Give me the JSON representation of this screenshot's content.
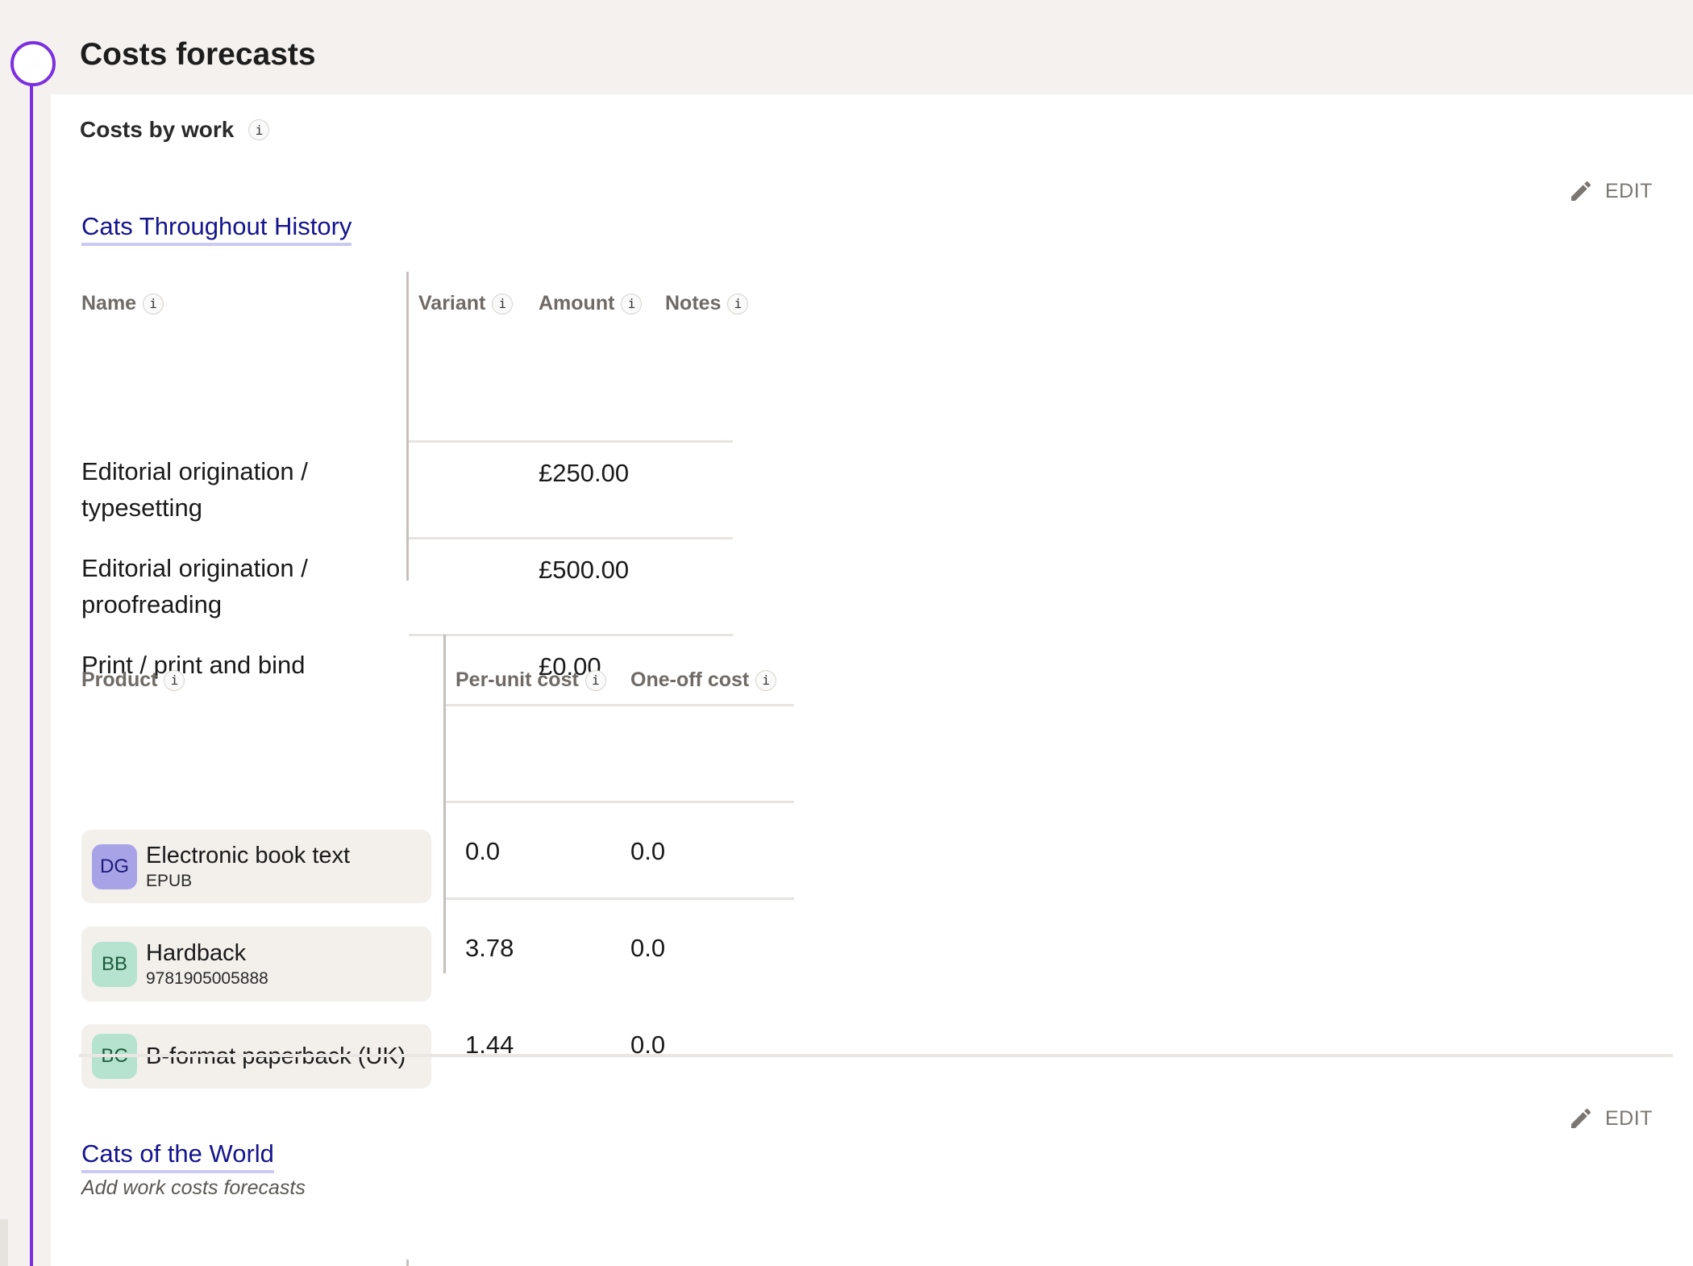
{
  "section": {
    "title": "Costs forecasts"
  },
  "costs_by_work": {
    "label": "Costs by work",
    "info": "i"
  },
  "edit_label": "EDIT",
  "works": [
    {
      "title": "Cats Throughout History",
      "cost_table": {
        "headers": {
          "name": "Name",
          "variant": "Variant",
          "amount": "Amount",
          "notes": "Notes"
        },
        "rows": [
          {
            "name_line1": "Editorial origination /",
            "name_line2": "typesetting",
            "variant": "",
            "amount": "£250.00",
            "notes": ""
          },
          {
            "name_line1": "Editorial origination /",
            "name_line2": "proofreading",
            "variant": "",
            "amount": "£500.00",
            "notes": ""
          },
          {
            "name_line1": "Print / print and bind",
            "name_line2": "",
            "variant": "",
            "amount": "£0.00",
            "notes": ""
          }
        ]
      },
      "product_table": {
        "headers": {
          "product": "Product",
          "per_unit": "Per-unit cost",
          "one_off": "One-off cost"
        },
        "rows": [
          {
            "badge": "DG",
            "name": "Electronic book text",
            "sub": "EPUB",
            "per_unit": "0.0",
            "one_off": "0.0",
            "badge_color": "#a7a3e6",
            "badge_text_color": "#1c1a7a"
          },
          {
            "badge": "BB",
            "name": "Hardback",
            "sub": "9781905005888",
            "per_unit": "3.78",
            "one_off": "0.0",
            "badge_color": "#b5e3cf",
            "badge_text_color": "#1c5a3c"
          },
          {
            "badge": "BC",
            "name": "B-format paperback (UK)",
            "sub": "",
            "per_unit": "1.44",
            "one_off": "0.0",
            "badge_color": "#b5e3cf",
            "badge_text_color": "#1c5a3c"
          }
        ]
      }
    },
    {
      "title": "Cats of the World",
      "subtitle": "Add work costs forecasts"
    }
  ],
  "colors": {
    "accent": "#7b2fe0",
    "link": "#14148c"
  }
}
